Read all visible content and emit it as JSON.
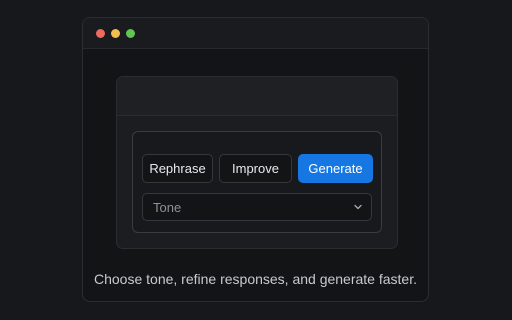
{
  "window": {
    "controls": [
      "close",
      "minimize",
      "maximize"
    ]
  },
  "toolbar": {
    "rephrase_label": "Rephrase",
    "improve_label": "Improve",
    "generate_label": "Generate"
  },
  "tone_select": {
    "value": "Tone",
    "icon": "chevron-down-icon"
  },
  "caption": "Choose tone, refine responses, and generate faster.",
  "colors": {
    "accent": "#1677e3",
    "background": "#17181b",
    "close": "#ec6a5e",
    "minimize": "#f4bf4f",
    "maximize": "#61c554"
  }
}
